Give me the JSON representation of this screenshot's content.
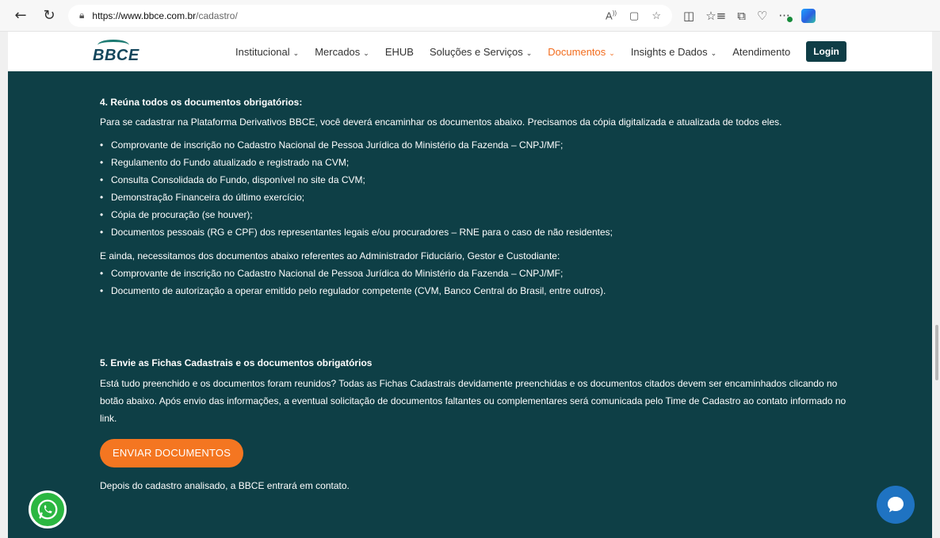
{
  "browser": {
    "url_host": "https://www.bbce.com.br",
    "url_path": "/cadastro/"
  },
  "header": {
    "logo_text": "BBCE",
    "menu": [
      {
        "label": "Institucional",
        "has_dropdown": true
      },
      {
        "label": "Mercados",
        "has_dropdown": true
      },
      {
        "label": "EHUB",
        "has_dropdown": false
      },
      {
        "label": "Soluções e Serviços",
        "has_dropdown": true
      },
      {
        "label": "Documentos",
        "has_dropdown": true,
        "active": true
      },
      {
        "label": "Insights e Dados",
        "has_dropdown": true
      },
      {
        "label": "Atendimento",
        "has_dropdown": false
      }
    ],
    "login_label": "Login",
    "active_color": "#f26c1d"
  },
  "section4": {
    "heading": "4. Reúna todos os documentos obrigatórios:",
    "intro": "Para se cadastrar na Plataforma Derivativos BBCE, você deverá encaminhar os documentos abaixo. Precisamos da cópia digitalizada e atualizada de todos eles.",
    "items": [
      "Comprovante de inscrição no Cadastro Nacional de Pessoa Jurídica do Ministério da Fazenda – CNPJ/MF;",
      "Regulamento do Fundo atualizado e registrado na CVM;",
      "Consulta Consolidada do Fundo, disponível no site da CVM;",
      "Demonstração Financeira do último exercício;",
      "Cópia de procuração (se houver);",
      "Documentos pessoais (RG e CPF) dos representantes legais e/ou procuradores – RNE para o caso de não residentes;"
    ],
    "extra_intro": "E ainda, necessitamos dos documentos abaixo referentes ao Administrador Fiduciário, Gestor e Custodiante:",
    "extra_items": [
      "Comprovante de inscrição no Cadastro Nacional de Pessoa Jurídica do Ministério da Fazenda – CNPJ/MF;",
      "Documento de autorização a operar emitido pelo regulador competente (CVM, Banco Central do Brasil, entre outros)."
    ]
  },
  "section5": {
    "heading": "5. Envie as Fichas Cadastrais e os documentos obrigatórios",
    "body": "Está tudo preenchido e os documentos foram reunidos? Todas as Fichas Cadastrais devidamente preenchidas e os documentos citados devem ser encaminhados clicando no botão abaixo. Após envio das informações, a eventual solicitação de documentos faltantes ou complementares será comunicada pelo Time de Cadastro ao contato informado no link.",
    "button_label": "ENVIAR DOCUMENTOS",
    "footer": "Depois do cadastro analisado, a BBCE entrará em contato."
  },
  "colors": {
    "main_bg": "#0e3f46",
    "button_orange": "#f47621",
    "whatsapp_green": "#2bb741",
    "chat_blue": "#1f73c2"
  }
}
